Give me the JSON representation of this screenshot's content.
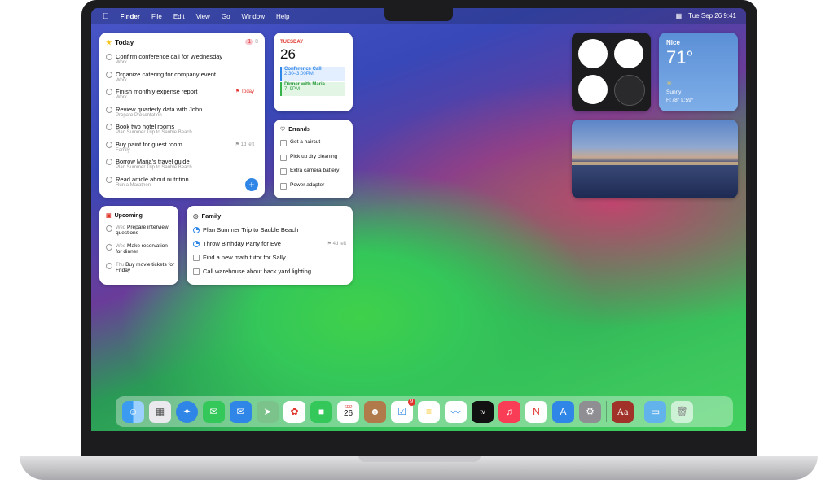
{
  "menubar": {
    "app": "Finder",
    "items": [
      "File",
      "Edit",
      "View",
      "Go",
      "Window",
      "Help"
    ],
    "datetime": "Tue Sep 26  9:41"
  },
  "today": {
    "title": "Today",
    "count": "1",
    "count2": "8",
    "items": [
      {
        "text": "Confirm conference call for Wednesday",
        "sub": "Work"
      },
      {
        "text": "Organize catering for company event",
        "sub": "Work"
      },
      {
        "text": "Finish monthly expense report",
        "sub": "Work",
        "tag": "Today"
      },
      {
        "text": "Review quarterly data with John",
        "sub": "Prepare Presentation"
      },
      {
        "text": "Book two hotel rooms",
        "sub": "Plan Summer Trip to Sauble Beach"
      },
      {
        "text": "Buy paint for guest room",
        "sub": "Family",
        "tag": "1d left"
      },
      {
        "text": "Borrow Maria's travel guide",
        "sub": "Plan Summer Trip to Sauble Beach"
      },
      {
        "text": "Read article about nutrition",
        "sub": "Run a Marathon"
      }
    ]
  },
  "calendar": {
    "day": "TUESDAY",
    "date": "26",
    "events": [
      {
        "title": "Conference Call",
        "time": "2:30–3:00PM",
        "color": "#2f86e6"
      },
      {
        "title": "Dinner with Maria",
        "time": "7–9PM",
        "color": "#36b24a"
      }
    ]
  },
  "errands": {
    "title": "Errands",
    "items": [
      "Get a haircut",
      "Pick up dry cleaning",
      "Extra camera battery",
      "Power adapter"
    ]
  },
  "upcoming": {
    "title": "Upcoming",
    "items": [
      {
        "day": "Wed",
        "text": "Prepare interview questions"
      },
      {
        "day": "Wed",
        "text": "Make reservation for dinner"
      },
      {
        "day": "Thu",
        "text": "Buy movie tickets for Friday"
      }
    ]
  },
  "family": {
    "title": "Family",
    "items": [
      {
        "text": "Plan Summer Trip to Sauble Beach"
      },
      {
        "text": "Throw Birthday Party for Eve",
        "tag": "4d left"
      },
      {
        "text": "Find a new math tutor for Sally"
      },
      {
        "text": "Call warehouse about back yard lighting"
      }
    ]
  },
  "weather": {
    "city": "Nice",
    "temp": "71°",
    "condition": "Sunny",
    "range": "H:78° L:59°"
  },
  "dock": {
    "calendar_month": "SEP",
    "calendar_day": "26",
    "reminders_badge": "9",
    "dictionary_label": "Aa"
  }
}
